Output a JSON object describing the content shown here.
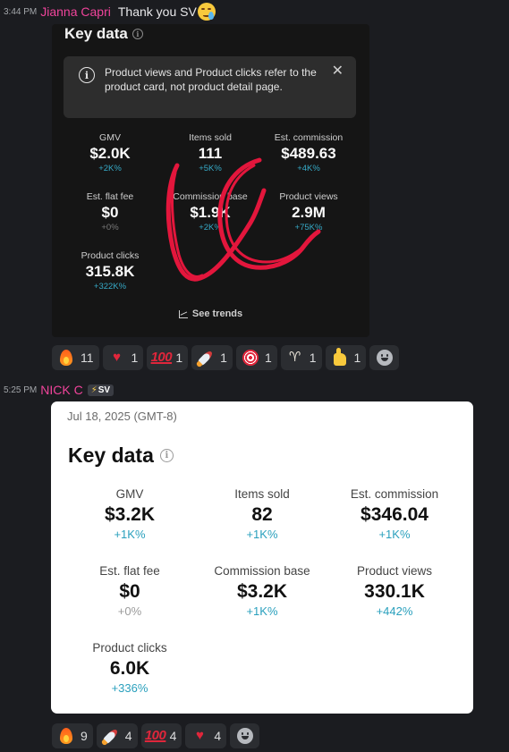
{
  "message1": {
    "timestamp": "3:44 PM",
    "username": "Jianna Capri",
    "text": "Thank you SV",
    "emoji": "crying-face-emoji"
  },
  "dark_card": {
    "title": "Key data",
    "banner_text": "Product views and Product clicks refer to the product card, not product detail page.",
    "close_label": "✕",
    "metrics": [
      {
        "label": "GMV",
        "value": "$2.0K",
        "change": "+2K%"
      },
      {
        "label": "Items sold",
        "value": "111",
        "change": "+5K%"
      },
      {
        "label": "Est. commission",
        "value": "$489.63",
        "change": "+4K%"
      },
      {
        "label": "Est. flat fee",
        "value": "$0",
        "change": "+0%"
      },
      {
        "label": "Commission base",
        "value": "$1.9K",
        "change": "+2K%"
      },
      {
        "label": "Product views",
        "value": "2.9M",
        "change": "+75K%"
      },
      {
        "label": "Product clicks",
        "value": "315.8K",
        "change": "+322K%"
      }
    ],
    "see_trends": "See trends",
    "scribble_color": "#e3163c"
  },
  "reactions1": [
    {
      "emoji": "fire-emoji",
      "count": "11"
    },
    {
      "emoji": "heart-emoji",
      "count": "1"
    },
    {
      "emoji": "hundred-points-emoji",
      "count": "1"
    },
    {
      "emoji": "rocket-emoji",
      "count": "1"
    },
    {
      "emoji": "direct-hit-emoji",
      "count": "1"
    },
    {
      "emoji": "goat-emoji",
      "count": "1"
    },
    {
      "emoji": "thumbs-up-emoji",
      "count": "1"
    }
  ],
  "message2": {
    "timestamp": "5:25 PM",
    "username": "NICK C",
    "tag": "SV"
  },
  "light_card": {
    "date": "Jul 18, 2025 (GMT-8)",
    "title": "Key data",
    "metrics": [
      {
        "label": "GMV",
        "value": "$3.2K",
        "change": "+1K%"
      },
      {
        "label": "Items sold",
        "value": "82",
        "change": "+1K%"
      },
      {
        "label": "Est. commission",
        "value": "$346.04",
        "change": "+1K%"
      },
      {
        "label": "Est. flat fee",
        "value": "$0",
        "change": "+0%"
      },
      {
        "label": "Commission base",
        "value": "$3.2K",
        "change": "+1K%"
      },
      {
        "label": "Product views",
        "value": "330.1K",
        "change": "+442%"
      },
      {
        "label": "Product clicks",
        "value": "6.0K",
        "change": "+336%"
      }
    ]
  },
  "reactions2": [
    {
      "emoji": "fire-emoji",
      "count": "9"
    },
    {
      "emoji": "rocket-emoji",
      "count": "4"
    },
    {
      "emoji": "hundred-points-emoji",
      "count": "4"
    },
    {
      "emoji": "heart-emoji",
      "count": "4"
    }
  ],
  "colors": {
    "background": "#1b1c20",
    "username": "#f0449b",
    "positive_change": "#36a9c6"
  }
}
